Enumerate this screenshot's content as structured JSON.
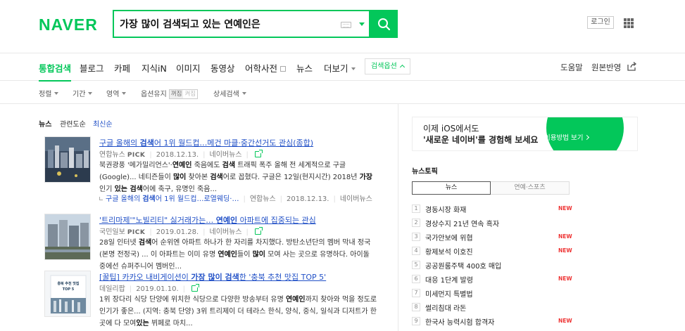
{
  "header": {
    "logo": "NAVER",
    "search_value": "가장 많이 검색되고 있는 연예인은",
    "login_label": "로그인"
  },
  "nav": {
    "items": [
      "통합검색",
      "블로그",
      "카페",
      "지식iN",
      "이미지",
      "동영상",
      "어학사전",
      "뉴스",
      "더보기"
    ],
    "search_options_label": "검색옵션",
    "help_label": "도움말",
    "feedback_label": "원본반영"
  },
  "filter": {
    "sort_label": "정렬",
    "period_label": "기간",
    "area_label": "영역",
    "option_keep_label": "옵션유지",
    "option_off": "꺼짐",
    "option_on": "켜짐",
    "detail_label": "상세검색"
  },
  "news_tabs": {
    "news": "뉴스",
    "relevance": "관련도순",
    "latest": "최신순"
  },
  "articles": [
    {
      "title_html": "구글 올해의 <b>검색</b>어 1위 월드컵…메건 마클·중간선거도 관심(종합)",
      "press": "연합뉴스",
      "pick": "PICK",
      "date": "2018.12.13.",
      "source": "네이버뉴스",
      "desc_html": "북권광풍 '메가밀리언스'·<b class=\"hl\">연예인</b> 죽음에도 <b class=\"hl\">검색</b> 트래픽 폭주 올해 전 세계적으로 구글(Google)... 네티즌들이 <b class=\"hl\">많이</b> 찾아본 <b class=\"hl\">검색</b>어로 꼽혔다. 구글은 12일(현지시간) 2018년 <b class=\"hl\">가장</b> 인기 <b class=\"hl\">있는 검색</b>어에 축구, 유명인 죽음...",
      "related_title_html": "구글 올해의 <b>검색</b>어 1위 월드컵…로열웨딩·…",
      "related_press": "연합뉴스",
      "related_date": "2018.12.13.",
      "related_source": "네이버뉴스"
    },
    {
      "title_html": "'트리마제'\"노빌리티\" 싫거래가는… <b>연예인</b> 아파트에 집중되는 관심",
      "press": "국민일보",
      "pick": "PICK",
      "date": "2019.01.28.",
      "source": "네이버뉴스",
      "desc_html": "28일 인터넷 <b class=\"hl\">검색</b>어 순위엔 아파트 하나가 한 자리를 차지했다. 방탄소년단의 멤버 막내 정국(본명 전정국) ... 이 아파트는 이미 유명 <b class=\"hl\">연예인</b>들이 <b class=\"hl\">많이</b> 모여 사는 곳으로 유명하다. 아이돌 중에선 슈퍼주니어 멤버인..."
    },
    {
      "title_html": "[꿀팁] 카카오 내비게이션이 <b>가장 많이 검색</b>한 '충북 추천 맛집 TOP 5'",
      "press": "데일리팝",
      "date": "2019.01.10.",
      "desc_html": "1위 장다리 식당 단양에 위치한 식당으로 다양한 방송부터 유명 <b class=\"hl\">연예인</b>까지 찾아와 먹을 정도로 인기가 좋은... (지역: 충북 단양) 3위 트리제이 더 테라스 한식, 양식, 중식, 일식과 디저트가 한곳에 다 모여<b class=\"hl\">있는</b> 뷔페로 마치..."
    }
  ],
  "thumb3_text": "충북 추천 맛집 TOP 5",
  "ad": {
    "line1": "이제 iOS에서도",
    "line2": "'새로운 네이버'를 경험해 보세요",
    "button": "이용방법 보기"
  },
  "topic": {
    "heading": "뉴스토픽",
    "tab_news": "뉴스",
    "tab_ent": "연예·스포츠",
    "new_label": "NEW",
    "items": [
      {
        "num": "1",
        "name": "경동시장 화재",
        "new": true
      },
      {
        "num": "2",
        "name": "경상수지 21년 연속 흑자",
        "new": false
      },
      {
        "num": "3",
        "name": "국가안보에 위협",
        "new": true
      },
      {
        "num": "4",
        "name": "황제보석 이호진",
        "new": true
      },
      {
        "num": "5",
        "name": "공공원룸주택 400호 매입",
        "new": false
      },
      {
        "num": "6",
        "name": "대응 1단계 발령",
        "new": true
      },
      {
        "num": "7",
        "name": "미세먼지 특별법",
        "new": false
      },
      {
        "num": "8",
        "name": "썰리침대 라돈",
        "new": false
      },
      {
        "num": "9",
        "name": "한국사 능력시험 합격자",
        "new": true
      }
    ]
  },
  "colors": {
    "brand": "#03c75a",
    "link": "#2251c7",
    "new": "#ee3333"
  }
}
